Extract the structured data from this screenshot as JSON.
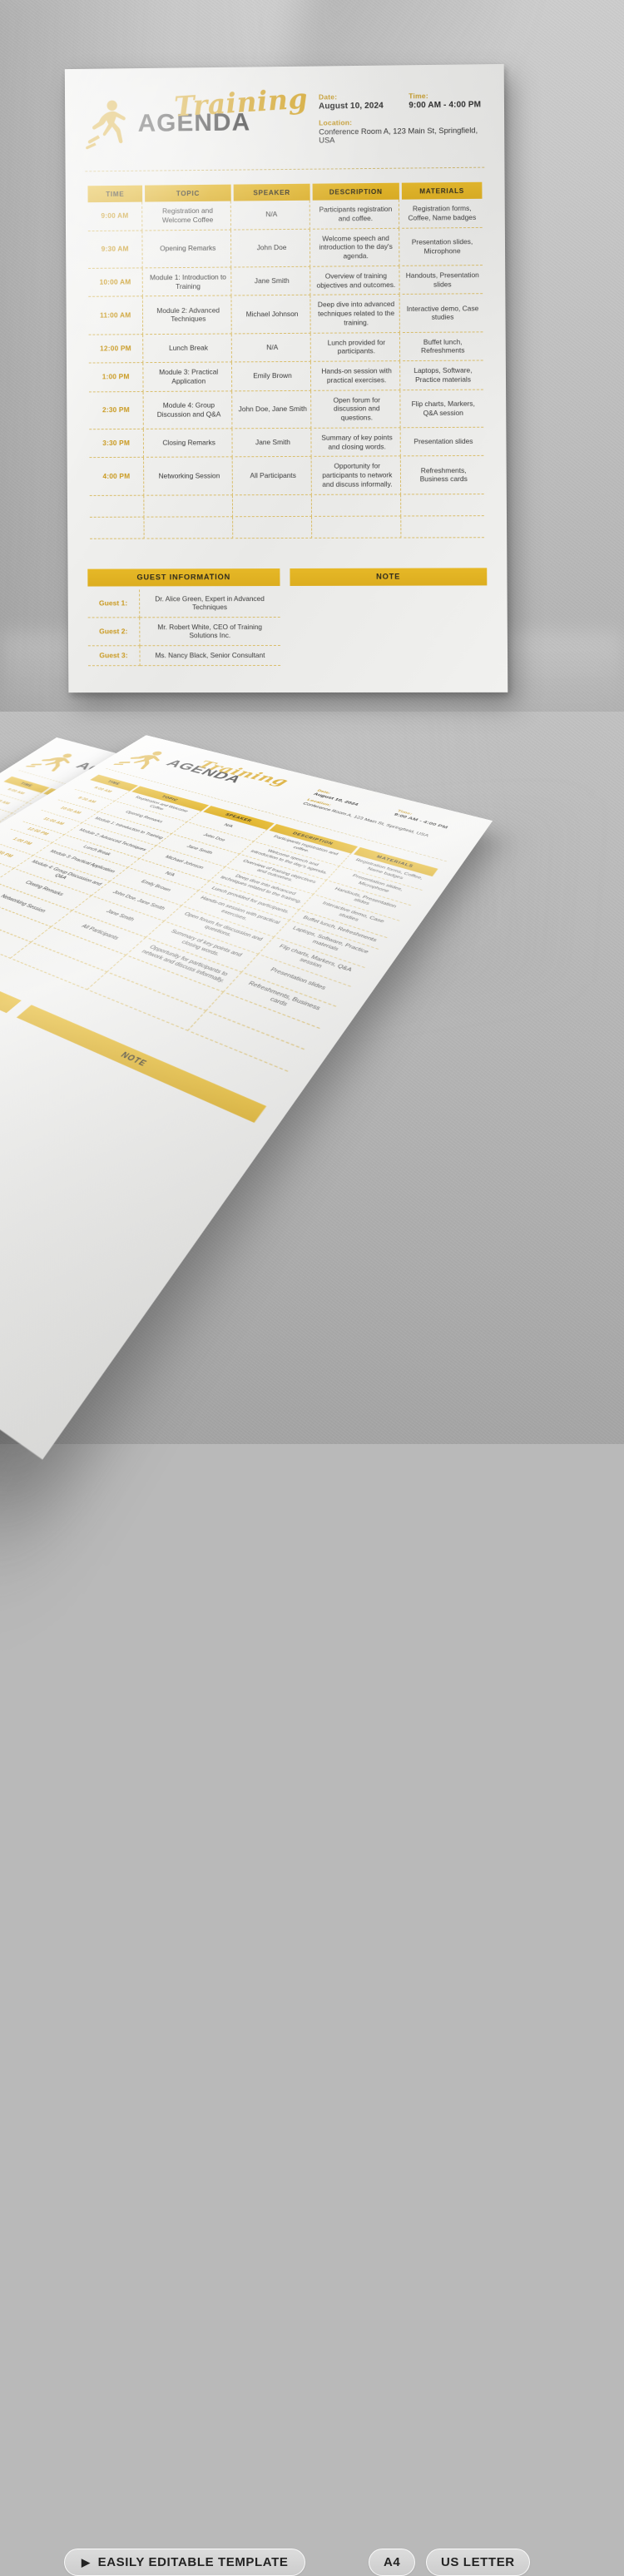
{
  "brand": {
    "accent": "#dcad1f",
    "accent_light": "#e6b827",
    "time_text": "#c9991f",
    "dark": "#3b3b3b"
  },
  "document": {
    "logo_icon": "running-person-icon",
    "title_script": "Training",
    "title_main": "AGENDA",
    "meta": {
      "date_label": "Date:",
      "date_value": "August 10, 2024",
      "time_label": "Time:",
      "time_value": "9:00 AM - 4:00 PM",
      "location_label": "Location:",
      "location_value": "Conference Room A, 123 Main St, Springfield, USA"
    },
    "table": {
      "headers": [
        "TIME",
        "TOPIC",
        "SPEAKER",
        "DESCRIPTION",
        "MATERIALS"
      ],
      "rows": [
        [
          "9:00 AM",
          "Registration and Welcome Coffee",
          "N/A",
          "Participants registration and coffee.",
          "Registration forms, Coffee, Name badges"
        ],
        [
          "9:30 AM",
          "Opening Remarks",
          "John Doe",
          "Welcome speech and introduction to the day's agenda.",
          "Presentation slides, Microphone"
        ],
        [
          "10:00 AM",
          "Module 1: Introduction to Training",
          "Jane Smith",
          "Overview of training objectives and outcomes.",
          "Handouts, Presentation slides"
        ],
        [
          "11:00 AM",
          "Module 2: Advanced Techniques",
          "Michael Johnson",
          "Deep dive into advanced techniques related to the training.",
          "Interactive demo, Case studies"
        ],
        [
          "12:00 PM",
          "Lunch Break",
          "N/A",
          "Lunch provided for participants.",
          "Buffet lunch, Refreshments"
        ],
        [
          "1:00 PM",
          "Module 3: Practical Application",
          "Emily Brown",
          "Hands-on session with practical exercises.",
          "Laptops, Software, Practice materials"
        ],
        [
          "2:30 PM",
          "Module 4: Group Discussion and Q&A",
          "John Doe, Jane Smith",
          "Open forum for discussion and questions.",
          "Flip charts, Markers, Q&A session"
        ],
        [
          "3:30 PM",
          "Closing Remarks",
          "Jane Smith",
          "Summary of key points and closing words.",
          "Presentation slides"
        ],
        [
          "4:00 PM",
          "Networking Session",
          "All Participants",
          "Opportunity for participants to network and discuss informally.",
          "Refreshments, Business cards"
        ],
        [
          "",
          "",
          "",
          "",
          ""
        ],
        [
          "",
          "",
          "",
          "",
          ""
        ]
      ]
    },
    "guest_panel": {
      "title": "GUEST INFORMATION",
      "rows": [
        {
          "label": "Guest 1:",
          "value": "Dr. Alice Green, Expert in Advanced Techniques"
        },
        {
          "label": "Guest 2:",
          "value": "Mr. Robert White, CEO of Training Solutions Inc."
        },
        {
          "label": "Guest 3:",
          "value": "Ms. Nancy Black, Senior Consultant"
        }
      ]
    },
    "note_panel": {
      "title": "NOTE",
      "body": ""
    }
  },
  "footer": {
    "editable_icon": "play-triangle-icon",
    "editable_label": "EASILY EDITABLE TEMPLATE",
    "size_a4": "A4",
    "size_us_letter": "US LETTER"
  }
}
